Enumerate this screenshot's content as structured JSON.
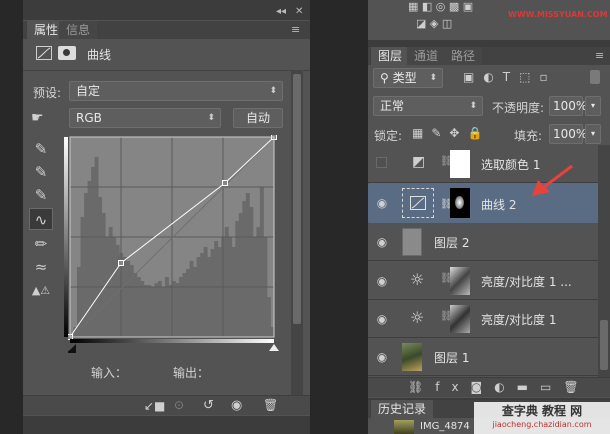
{
  "properties": {
    "tabs": [
      {
        "label": "属性",
        "active": true
      },
      {
        "label": "信息",
        "active": false
      }
    ],
    "collapse_glyph": "◂◂",
    "close_glyph": "✕",
    "menu_glyph": "≡",
    "panel_title": "曲线",
    "preset_label": "预设:",
    "preset_value": "自定",
    "channel_value": "RGB",
    "auto_button": "自动",
    "input_label": "输入：",
    "output_label": "输出：",
    "curve_points": [
      [
        0,
        0
      ],
      [
        0.25,
        0.37
      ],
      [
        0.76,
        0.77
      ],
      [
        1,
        1
      ]
    ],
    "histogram": [
      0,
      0.05,
      0.35,
      0.6,
      0.72,
      0.78,
      0.85,
      0.9,
      0.7,
      0.62,
      0.5,
      0.55,
      0.5,
      0.46,
      0.42,
      0.4,
      0.38,
      0.36,
      0.32,
      0.3,
      0.28,
      0.26,
      0.26,
      0.25,
      0.27,
      0.28,
      0.25,
      0.3,
      0.26,
      0.28,
      0.27,
      0.3,
      0.32,
      0.34,
      0.38,
      0.35,
      0.4,
      0.42,
      0.45,
      0.4,
      0.44,
      0.48,
      0.45,
      0.5,
      0.55,
      0.5,
      0.45,
      0.58,
      0.62,
      0.68,
      0.72,
      0.65,
      0.5,
      0.55,
      0.75,
      0.5,
      0.2,
      0.05
    ]
  },
  "layers": {
    "tabs": [
      {
        "label": "图层",
        "active": true
      },
      {
        "label": "通道",
        "active": false
      },
      {
        "label": "路径",
        "active": false
      }
    ],
    "filter_type": "类型",
    "blend_mode": "正常",
    "opacity_label": "不透明度:",
    "opacity_value": "100%",
    "lock_label": "锁定:",
    "fill_label": "填充:",
    "fill_value": "100%",
    "items": [
      {
        "name": "选取颜色 1",
        "kind": "adjustment",
        "visible": false,
        "selected": false
      },
      {
        "name": "曲线 2",
        "kind": "curves",
        "visible": true,
        "selected": true
      },
      {
        "name": "图层 2",
        "kind": "pixel",
        "visible": true,
        "selected": false
      },
      {
        "name": "亮度/对比度 1 ...",
        "kind": "brightness",
        "visible": true,
        "selected": false
      },
      {
        "name": "亮度/对比度 1",
        "kind": "brightness",
        "visible": true,
        "selected": false
      },
      {
        "name": "图层 1",
        "kind": "photo",
        "visible": true,
        "selected": false
      }
    ],
    "history_tab": "历史记录",
    "history_item": "IMG_4874",
    "watermark_top": "查字典 教程 网",
    "watermark_url": "jiaocheng.chazidian.com",
    "top_watermark": "WWW.MISSYUAN.COM",
    "accent": "#e8423c"
  }
}
